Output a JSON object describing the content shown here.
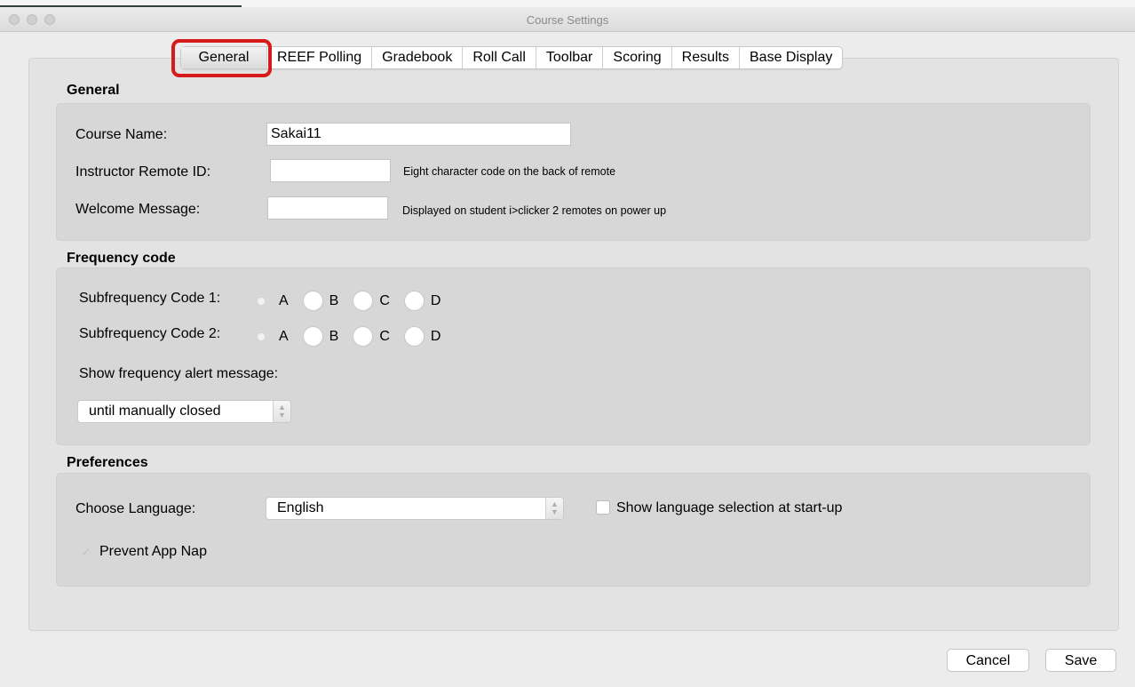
{
  "window": {
    "title": "Course Settings"
  },
  "tabs": [
    {
      "label": "General",
      "active": true
    },
    {
      "label": "REEF Polling"
    },
    {
      "label": "Gradebook"
    },
    {
      "label": "Roll Call"
    },
    {
      "label": "Toolbar"
    },
    {
      "label": "Scoring"
    },
    {
      "label": "Results"
    },
    {
      "label": "Base Display"
    }
  ],
  "general": {
    "header": "General",
    "course_name_label": "Course Name:",
    "course_name_value": "Sakai11",
    "instructor_id_label": "Instructor Remote ID:",
    "instructor_id_value": "",
    "instructor_id_hint": "Eight character code on the back of remote",
    "welcome_label": "Welcome Message:",
    "welcome_value": "",
    "welcome_hint": "Displayed on student i>clicker 2 remotes on power up"
  },
  "frequency": {
    "header": "Frequency code",
    "code1_label": "Subfrequency Code 1:",
    "code2_label": "Subfrequency Code 2:",
    "options": [
      "A",
      "B",
      "C",
      "D"
    ],
    "code1_selected": "A",
    "code2_selected": "A",
    "alert_label": "Show frequency alert message:",
    "alert_value": "until manually closed"
  },
  "preferences": {
    "header": "Preferences",
    "language_label": "Choose Language:",
    "language_value": "English",
    "show_language_label": "Show language selection at start-up",
    "show_language_checked": false,
    "app_nap_label": "Prevent App Nap",
    "app_nap_checked": true
  },
  "footer": {
    "cancel_label": "Cancel",
    "save_label": "Save"
  },
  "colors": {
    "highlight": "#d71a1a"
  }
}
